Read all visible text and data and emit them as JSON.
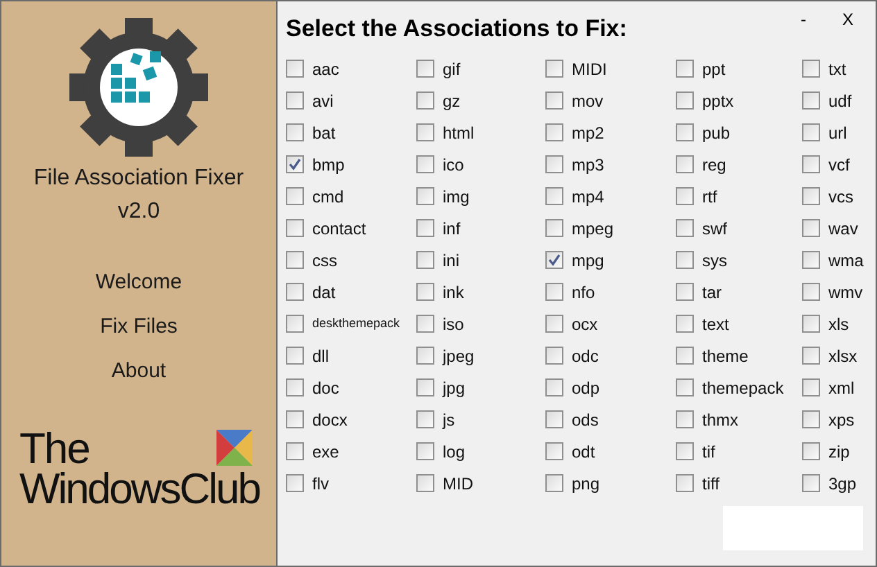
{
  "sidebar": {
    "app_title": "File Association Fixer",
    "version": "v2.0",
    "items": [
      {
        "label": "Welcome"
      },
      {
        "label": "Fix Files"
      },
      {
        "label": "About"
      }
    ],
    "brand": {
      "line_1": "The",
      "line_2": "WindowsClub"
    }
  },
  "window_controls": {
    "minimize": "-",
    "close": "X"
  },
  "heading": "Select the Associations to Fix:",
  "columns": [
    {
      "items": [
        {
          "label": "aac",
          "checked": false
        },
        {
          "label": "avi",
          "checked": false
        },
        {
          "label": "bat",
          "checked": false
        },
        {
          "label": "bmp",
          "checked": true
        },
        {
          "label": "cmd",
          "checked": false
        },
        {
          "label": "contact",
          "checked": false
        },
        {
          "label": "css",
          "checked": false
        },
        {
          "label": "dat",
          "checked": false
        },
        {
          "label": "deskthemepack",
          "checked": false,
          "compact": true
        },
        {
          "label": "dll",
          "checked": false
        },
        {
          "label": "doc",
          "checked": false
        },
        {
          "label": "docx",
          "checked": false
        },
        {
          "label": "exe",
          "checked": false
        },
        {
          "label": "flv",
          "checked": false
        }
      ]
    },
    {
      "items": [
        {
          "label": "gif",
          "checked": false
        },
        {
          "label": "gz",
          "checked": false
        },
        {
          "label": "html",
          "checked": false
        },
        {
          "label": "ico",
          "checked": false
        },
        {
          "label": "img",
          "checked": false
        },
        {
          "label": "inf",
          "checked": false
        },
        {
          "label": "ini",
          "checked": false
        },
        {
          "label": "ink",
          "checked": false
        },
        {
          "label": "iso",
          "checked": false
        },
        {
          "label": "jpeg",
          "checked": false
        },
        {
          "label": "jpg",
          "checked": false
        },
        {
          "label": "js",
          "checked": false
        },
        {
          "label": "log",
          "checked": false
        },
        {
          "label": "MID",
          "checked": false
        }
      ]
    },
    {
      "items": [
        {
          "label": "MIDI",
          "checked": false
        },
        {
          "label": "mov",
          "checked": false
        },
        {
          "label": "mp2",
          "checked": false
        },
        {
          "label": "mp3",
          "checked": false
        },
        {
          "label": "mp4",
          "checked": false
        },
        {
          "label": "mpeg",
          "checked": false
        },
        {
          "label": "mpg",
          "checked": true
        },
        {
          "label": "nfo",
          "checked": false
        },
        {
          "label": "ocx",
          "checked": false
        },
        {
          "label": "odc",
          "checked": false
        },
        {
          "label": "odp",
          "checked": false
        },
        {
          "label": "ods",
          "checked": false
        },
        {
          "label": "odt",
          "checked": false
        },
        {
          "label": "png",
          "checked": false
        }
      ]
    },
    {
      "items": [
        {
          "label": "ppt",
          "checked": false
        },
        {
          "label": "pptx",
          "checked": false
        },
        {
          "label": "pub",
          "checked": false
        },
        {
          "label": "reg",
          "checked": false
        },
        {
          "label": "rtf",
          "checked": false
        },
        {
          "label": "swf",
          "checked": false
        },
        {
          "label": "sys",
          "checked": false
        },
        {
          "label": "tar",
          "checked": false
        },
        {
          "label": "text",
          "checked": false
        },
        {
          "label": "theme",
          "checked": false
        },
        {
          "label": "themepack",
          "checked": false
        },
        {
          "label": "thmx",
          "checked": false
        },
        {
          "label": "tif",
          "checked": false
        },
        {
          "label": "tiff",
          "checked": false
        }
      ]
    },
    {
      "items": [
        {
          "label": "txt",
          "checked": false
        },
        {
          "label": "udf",
          "checked": false
        },
        {
          "label": "url",
          "checked": false
        },
        {
          "label": "vcf",
          "checked": false
        },
        {
          "label": "vcs",
          "checked": false
        },
        {
          "label": "wav",
          "checked": false
        },
        {
          "label": "wma",
          "checked": false
        },
        {
          "label": "wmv",
          "checked": false
        },
        {
          "label": "xls",
          "checked": false
        },
        {
          "label": "xlsx",
          "checked": false
        },
        {
          "label": "xml",
          "checked": false
        },
        {
          "label": "xps",
          "checked": false
        },
        {
          "label": "zip",
          "checked": false
        },
        {
          "label": "3gp",
          "checked": false
        }
      ]
    }
  ]
}
